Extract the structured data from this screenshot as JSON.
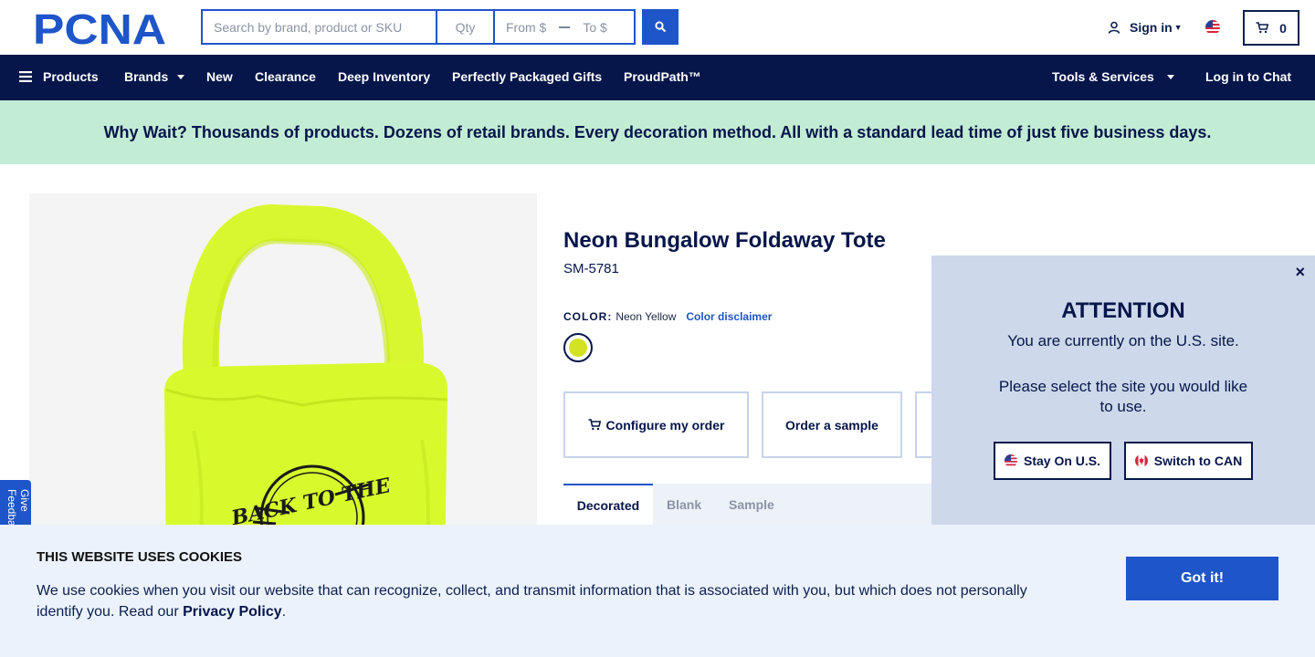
{
  "header": {
    "logo_text": "PCNA",
    "search_placeholder": "Search by brand, product or SKU",
    "qty_placeholder": "Qty",
    "from_placeholder": "From $",
    "to_placeholder": "To $",
    "signin_label": "Sign in",
    "cart_count": "0"
  },
  "nav": {
    "products": "Products",
    "brands": "Brands",
    "new": "New",
    "clearance": "Clearance",
    "deep_inventory": "Deep Inventory",
    "gifts": "Perfectly Packaged Gifts",
    "proudpath": "ProudPath™",
    "tools": "Tools & Services",
    "login_chat": "Log in to Chat"
  },
  "banner": {
    "text": "Why Wait? Thousands of products. Dozens of retail brands. Every decoration method. All with a standard lead time of just five business days."
  },
  "product": {
    "title": "Neon Bungalow Foldaway Tote",
    "sku": "SM-5781",
    "color_label": "COLOR:",
    "color_value": "Neon Yellow",
    "color_disclaimer": "Color disclaimer",
    "swatch_color": "#d3e324",
    "configure_label": "Configure my order",
    "sample_label": "Order a sample",
    "print_text": "BACK TO THE"
  },
  "tabs": [
    "Decorated",
    "Blank",
    "Sample"
  ],
  "feedback_label": "Give Feedback",
  "site_popup": {
    "close": "×",
    "heading": "ATTENTION",
    "line1": "You are currently on the U.S. site.",
    "line2": "Please select the site you would like to use.",
    "stay_label": "Stay On U.S.",
    "switch_label": "Switch to CAN"
  },
  "cookie": {
    "heading": "THIS WEBSITE USES COOKIES",
    "text": "We use cookies when you visit our website that can recognize, collect, and transmit information that is associated with you, but which does not personally identify you. Read our ",
    "link": "Privacy Policy",
    "period": ".",
    "button": "Got it!"
  },
  "colors": {
    "navy": "#06164a",
    "accent": "#1e55c8",
    "banner_bg": "#c3ecd5"
  }
}
